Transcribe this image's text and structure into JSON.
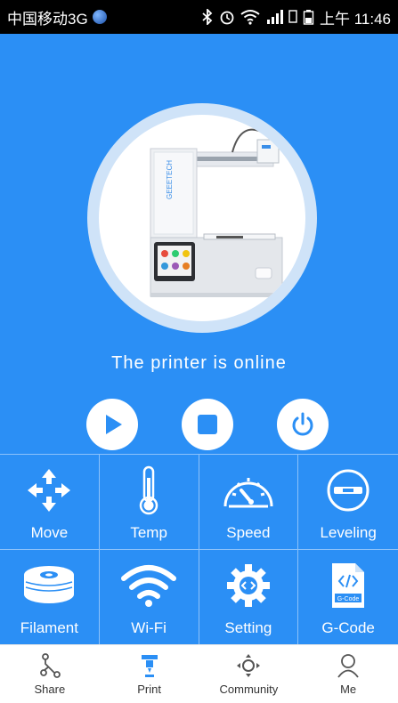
{
  "status_bar": {
    "carrier": "中国移动3G",
    "time": "上午 11:46"
  },
  "printer": {
    "status_text": "The printer is online"
  },
  "controls": [
    {
      "name": "play",
      "icon": "play-icon"
    },
    {
      "name": "stop",
      "icon": "stop-icon"
    },
    {
      "name": "power",
      "icon": "power-icon"
    }
  ],
  "tiles": [
    {
      "label": "Move",
      "icon": "move-arrows-icon"
    },
    {
      "label": "Temp",
      "icon": "thermometer-icon"
    },
    {
      "label": "Speed",
      "icon": "speedometer-icon"
    },
    {
      "label": "Leveling",
      "icon": "level-icon"
    },
    {
      "label": "Filament",
      "icon": "filament-spool-icon"
    },
    {
      "label": "Wi-Fi",
      "icon": "wifi-icon"
    },
    {
      "label": "Setting",
      "icon": "gear-icon"
    },
    {
      "label": "G-Code",
      "icon": "gcode-file-icon",
      "icon_text": "G-Code"
    }
  ],
  "tabs": [
    {
      "label": "Share",
      "icon": "share-icon",
      "active": false
    },
    {
      "label": "Print",
      "icon": "print-icon",
      "active": true
    },
    {
      "label": "Community",
      "icon": "community-icon",
      "active": false
    },
    {
      "label": "Me",
      "icon": "person-icon",
      "active": false
    }
  ],
  "colors": {
    "primary": "#2b8ff5",
    "divider": "#8cc2fa",
    "tab_active": "#2b8ff5",
    "tab_inactive": "#555555"
  }
}
